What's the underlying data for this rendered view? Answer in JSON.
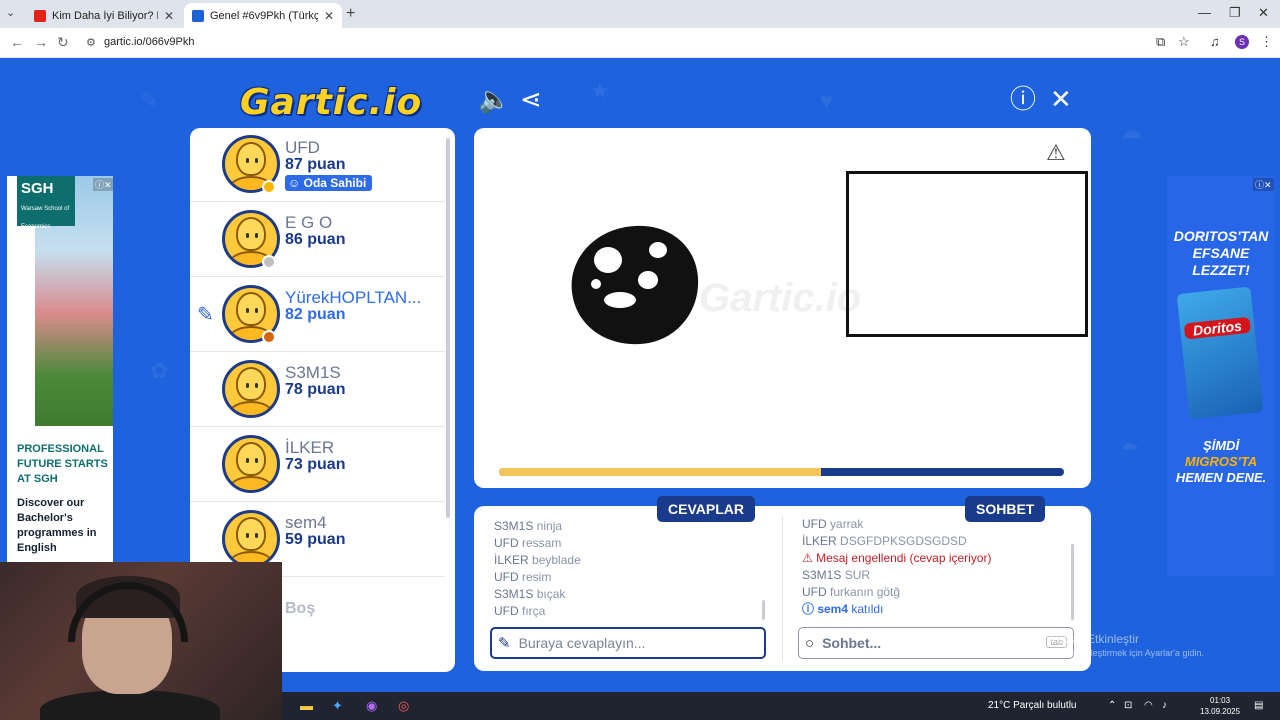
{
  "browser": {
    "tabs": [
      {
        "title": "Kim Daha İyi Biliyor? EA SPORTS FC",
        "favicon_color": "#e62117",
        "active": false
      },
      {
        "title": "Genel #6v9Pkh (Türkçe) - Gartic.io",
        "favicon_color": "#1a62d6",
        "active": true
      }
    ],
    "url": "gartic.io/066v9Pkh",
    "profile_initial": "S"
  },
  "game": {
    "logo": "Gartic.io",
    "players": [
      {
        "name": "UFD",
        "score": "87 puan",
        "badge": "Oda Sahibi",
        "status_color": "#f7b500",
        "drawing": false
      },
      {
        "name": "E G O",
        "score": "86 puan",
        "status_color": "#bfbfbf",
        "drawing": false
      },
      {
        "name": "YürekHOPLTAN...",
        "score": "82 puan",
        "status_color": "#d4640f",
        "drawing": true
      },
      {
        "name": "S3M1S",
        "score": "78 puan",
        "status_color": null,
        "drawing": false
      },
      {
        "name": "İLKER",
        "score": "73 puan",
        "status_color": null,
        "drawing": false
      },
      {
        "name": "sem4",
        "score": "59 puan",
        "status_color": null,
        "drawing": false
      }
    ],
    "empty_slot": "Boş",
    "timer_fraction": 0.57,
    "answers_label": "CEVAPLAR",
    "chat_label": "SOHBET",
    "answers": [
      {
        "name": "S3M1S",
        "text": "ninja"
      },
      {
        "name": "UFD",
        "text": "ressam"
      },
      {
        "name": "İLKER",
        "text": "beyblade"
      },
      {
        "name": "UFD",
        "text": "resim"
      },
      {
        "name": "S3M1S",
        "text": "bıçak"
      },
      {
        "name": "UFD",
        "text": "fırça"
      }
    ],
    "chat": [
      {
        "name": "UFD",
        "text": "yarrak",
        "type": "normal"
      },
      {
        "name": "İLKER",
        "text": "DSGFDPKSGDSGDSD",
        "type": "normal"
      },
      {
        "name": "",
        "text": "⚠ Mesaj engellendi (cevap içeriyor)",
        "type": "blocked"
      },
      {
        "name": "S3M1S",
        "text": "SUR",
        "type": "normal"
      },
      {
        "name": "UFD",
        "text": "furkanın götğ",
        "type": "normal"
      },
      {
        "name": "ⓘ sem4",
        "text": "katıldı",
        "type": "system"
      }
    ],
    "answer_placeholder": "Buraya cevaplayın...",
    "chat_placeholder": "Sohbet...",
    "tab_key": "tab"
  },
  "ads": {
    "left": {
      "logo": "SGH",
      "logo_sub": "Warsaw School of Economics",
      "headline": "PROFESSIONAL FUTURE STARTS AT SGH",
      "body": "Discover our Bachelor's programmes in English"
    },
    "right": {
      "headline": "DORITOS'TAN EFSANE LEZZET!",
      "brand": "Doritos",
      "footer_pre": "ŞİMDİ",
      "footer_store": "MIGROS'TA",
      "footer_post": "HEMEN DENE."
    }
  },
  "windows": {
    "activate_title": "Windows'u Etkinleştir",
    "activate_sub": "Windows'u etkinleştirmek için Ayarlar'a gidin.",
    "weather": "21°C  Parçalı bulutlu",
    "time": "01:03",
    "date": "13.09.2025"
  }
}
